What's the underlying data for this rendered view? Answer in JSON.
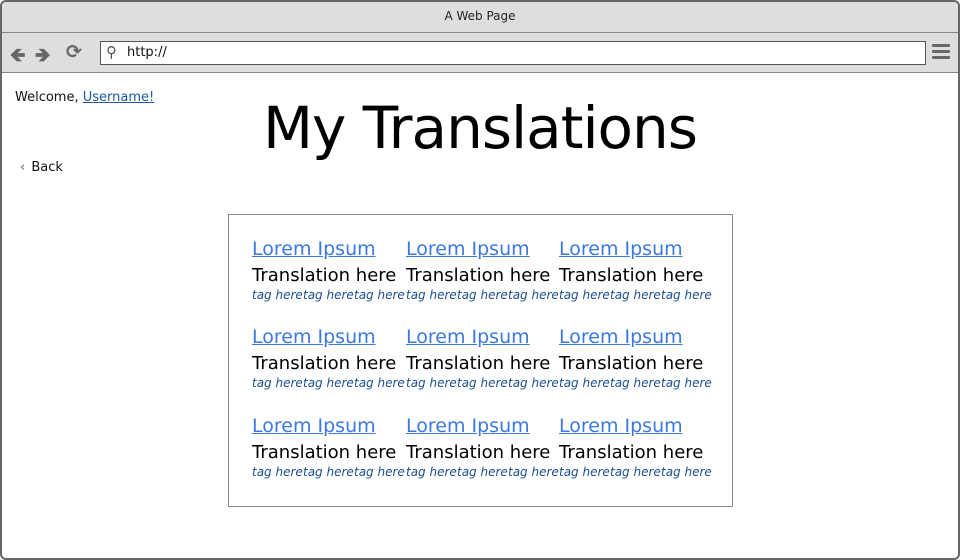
{
  "window": {
    "title": "A Web Page"
  },
  "browser": {
    "url": "http://"
  },
  "header": {
    "welcome": "Welcome,",
    "username": "Username!",
    "back": "Back",
    "title": "My Translations"
  },
  "translations": [
    {
      "title": "Lorem Ipsum",
      "translation": "Translation here",
      "tags": [
        "tag here",
        "tag here",
        "tag here"
      ]
    },
    {
      "title": "Lorem Ipsum",
      "translation": "Translation here",
      "tags": [
        "tag here",
        "tag here",
        "tag here"
      ]
    },
    {
      "title": "Lorem Ipsum",
      "translation": "Translation here",
      "tags": [
        "tag here",
        "tag here",
        "tag here"
      ]
    },
    {
      "title": "Lorem Ipsum",
      "translation": "Translation here",
      "tags": [
        "tag here",
        "tag here",
        "tag here"
      ]
    },
    {
      "title": "Lorem Ipsum",
      "translation": "Translation here",
      "tags": [
        "tag here",
        "tag here",
        "tag here"
      ]
    },
    {
      "title": "Lorem Ipsum",
      "translation": "Translation here",
      "tags": [
        "tag here",
        "tag here",
        "tag here"
      ]
    },
    {
      "title": "Lorem Ipsum",
      "translation": "Translation here",
      "tags": [
        "tag here",
        "tag here",
        "tag here"
      ]
    },
    {
      "title": "Lorem Ipsum",
      "translation": "Translation here",
      "tags": [
        "tag here",
        "tag here",
        "tag here"
      ]
    },
    {
      "title": "Lorem Ipsum",
      "translation": "Translation here",
      "tags": [
        "tag here",
        "tag here",
        "tag here"
      ]
    }
  ]
}
